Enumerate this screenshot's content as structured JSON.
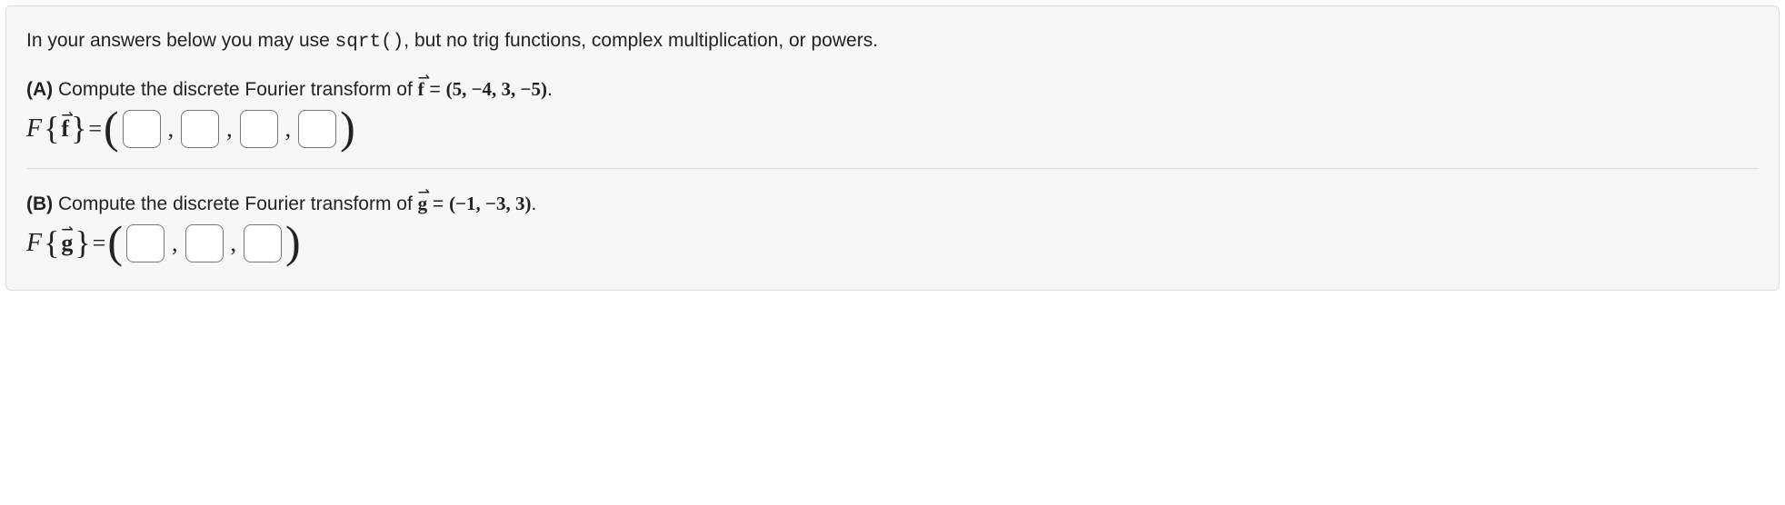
{
  "instructions": {
    "pre": "In your answers below you may use ",
    "code": "sqrt()",
    "post": ", but no trig functions, complex multiplication, or powers."
  },
  "partA": {
    "label": "(A)",
    "text_pre": " Compute the discrete Fourier transform of ",
    "vec_letter": "f",
    "eq": " = ",
    "vector": "(5, −4, 3, −5)",
    "period": ".",
    "lhs_F": "F",
    "lhs_vec": "f",
    "equals": " = ",
    "comma": ", ",
    "num_inputs": 4
  },
  "partB": {
    "label": "(B)",
    "text_pre": " Compute the discrete Fourier transform of ",
    "vec_letter": "g",
    "eq": " = ",
    "vector": "(−1, −3, 3)",
    "period": ".",
    "lhs_F": "F",
    "lhs_vec": "g",
    "equals": " = ",
    "comma": ", ",
    "num_inputs": 3
  }
}
